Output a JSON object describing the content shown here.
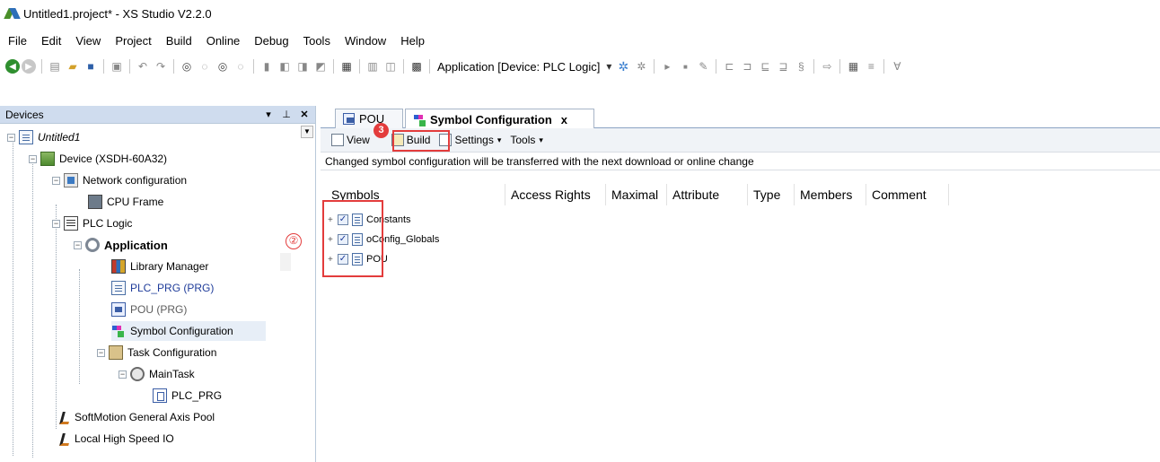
{
  "window": {
    "title": "Untitled1.project* - XS Studio V2.2.0"
  },
  "menu": [
    "File",
    "Edit",
    "View",
    "Project",
    "Build",
    "Online",
    "Debug",
    "Tools",
    "Window",
    "Help"
  ],
  "toolbar": {
    "device_label": "Application [Device: PLC Logic]"
  },
  "devices": {
    "header": "Devices",
    "tree": [
      {
        "label": "Untitled1"
      },
      {
        "label": "Device (XSDH-60A32)"
      },
      {
        "label": "Network configuration"
      },
      {
        "label": "CPU Frame"
      },
      {
        "label": "PLC Logic"
      },
      {
        "label": "Application"
      },
      {
        "label": "Library Manager"
      },
      {
        "label": "PLC_PRG (PRG)"
      },
      {
        "label": "POU (PRG)"
      },
      {
        "label": "Symbol Configuration"
      },
      {
        "label": "Task Configuration"
      },
      {
        "label": "MainTask"
      },
      {
        "label": "PLC_PRG"
      },
      {
        "label": "SoftMotion General Axis Pool"
      },
      {
        "label": "Local High Speed IO"
      }
    ],
    "callout": "②"
  },
  "editor": {
    "tabs": [
      {
        "label": "POU"
      },
      {
        "label": "Symbol Configuration",
        "close": "x"
      }
    ],
    "toolbar": {
      "view": "View",
      "build": "Build",
      "settings": "Settings",
      "tools": "Tools",
      "callout": "3"
    },
    "info": "Changed symbol configuration will be transferred with the next download or online change",
    "columns": [
      "Symbols",
      "Access Rights",
      "Maximal",
      "Attribute",
      "Type",
      "Members",
      "Comment"
    ],
    "symbols": [
      {
        "label": "Constants"
      },
      {
        "label": "oConfig_Globals"
      },
      {
        "label": "POU"
      }
    ]
  }
}
